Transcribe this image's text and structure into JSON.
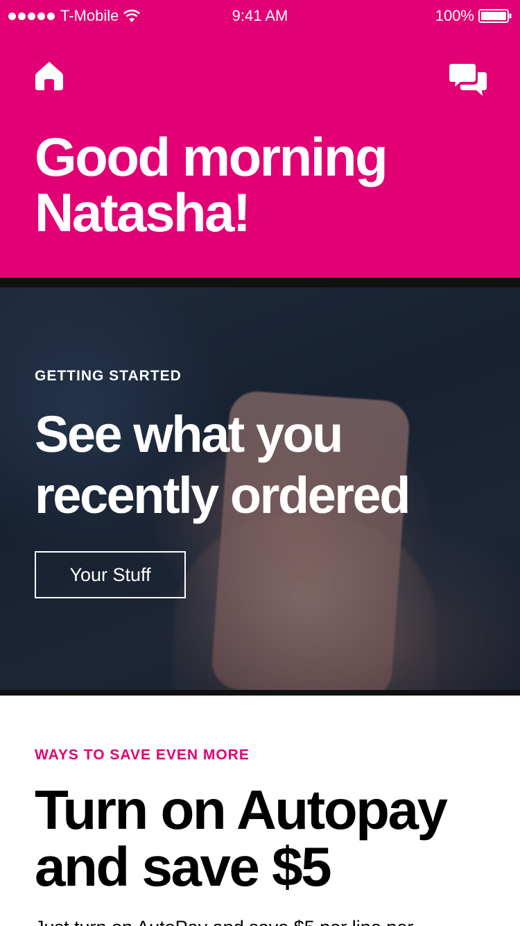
{
  "status_bar": {
    "carrier": "T-Mobile",
    "time": "9:41 AM",
    "battery": "100%"
  },
  "header": {
    "greeting": "Good morning Natasha!",
    "background_color": "#E20074",
    "icons": [
      "home-icon",
      "chat-icon"
    ]
  },
  "hero": {
    "eyebrow": "GETTING STARTED",
    "title": "See what you recently ordered",
    "button_label": "Your Stuff"
  },
  "autopay_card": {
    "eyebrow": "WAYS TO SAVE EVEN MORE",
    "title": "Turn on Autopay and save $5",
    "body": "Just turn on AutoPay and save $5 per line per"
  },
  "colors": {
    "brand_magenta": "#E20074",
    "text_dark": "#000000",
    "text_light": "#ffffff"
  }
}
